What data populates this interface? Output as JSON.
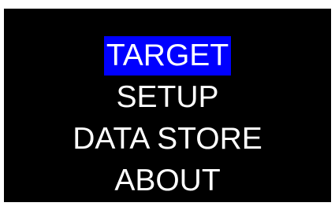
{
  "colors": {
    "screen_background": "#000000",
    "text": "#ffffff",
    "selection_highlight": "#0000ff"
  },
  "menu": {
    "selected_index": 0,
    "items": [
      {
        "label": "TARGET"
      },
      {
        "label": "SETUP"
      },
      {
        "label": "DATA STORE"
      },
      {
        "label": "ABOUT"
      }
    ]
  }
}
